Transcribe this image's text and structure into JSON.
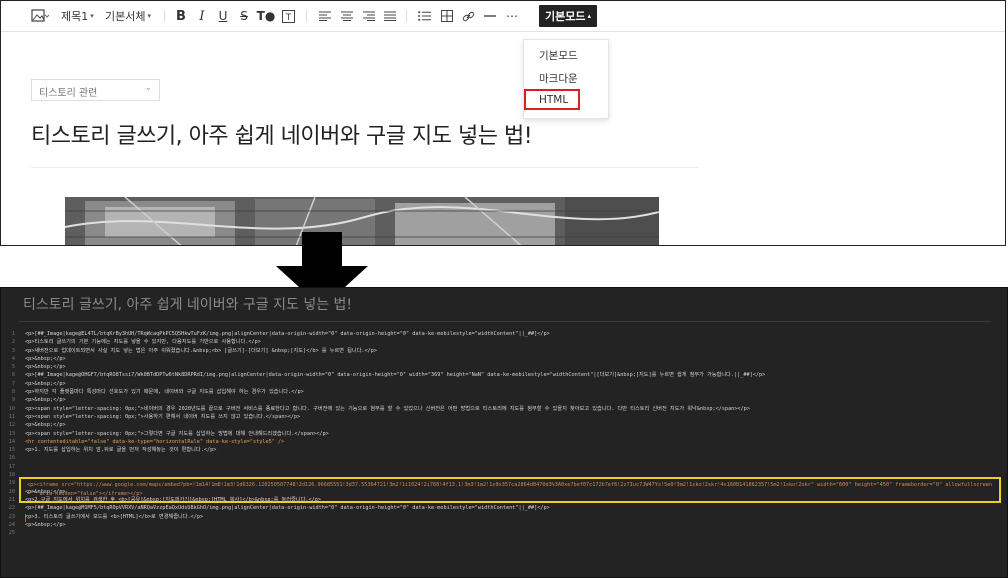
{
  "toolbar": {
    "heading_label": "제목1",
    "font_label": "기본서체",
    "mode_label": "기본모드",
    "mode_menu": [
      "기본모드",
      "마크다운",
      "HTML"
    ]
  },
  "editor": {
    "category": "티스토리 관련",
    "title": "티스토리 글쓰기, 아주 쉽게 네이버와 구글 지도 넣는 법!"
  },
  "source": {
    "title": "티스토리 글쓰기, 아주 쉽게 네이버와 구글 지도 넣는 법!",
    "line_numbers": [
      "1",
      "2",
      "3",
      "4",
      "5",
      "6",
      "7",
      "8",
      "9",
      "10",
      "11",
      "12",
      "13",
      "14",
      "15",
      "16",
      "17",
      "18",
      "19",
      "20",
      "21",
      "22",
      "23",
      "24",
      "25"
    ],
    "lines": [
      "<p>[##_Image|kage@EL4TL/btqKrBy3hUH/TRqWcaqPkPC5Q5HkwTuFzK/img.png|alignCenter|data-origin-width=\"0\" data-origin-height=\"0\" data-ke-mobilestyle=\"widthContent\"||_##]</p>",
      "<p>티스토리 글쓰기의 기본 기능에는 지도를 넣을 수 있지만, 다음지도를 기반으로 사용합니다.</p>",
      "<p>새버전으로 업데이트되면서 사실 지도 넣는 법은 아주 쉬워졌습니다.&nbsp;<b> [글쓰기]-[더보기] &nbsp;[지도]</b> 를 누르면 됩니다.</p>",
      "<p>&nbsp;</p>",
      "<p>&nbsp;</p>",
      "<p>[##_Image|kage@OHGF7/btqRO8Tssi7/Wk0BTdDPTw6tNk8DRPRdI/img.png|alignCenter|data-origin-width=\"0\" data-origin-height=\"0\" width=\"369\" height=\"NaN\" data-ke-mobilestyle=\"widthContent\"|[더보기]&nbsp;[지도]를 누르면 쉽게 첨부가 가능합니다.||_##]</p>",
      "<p>&nbsp;</p>",
      "<p>하지만 각 플랫폼마다 특성마다 선호도가 있기 때문에, 네이버와 구글 지도를 삽입해야 하는 경우가 있습니다.</p>",
      "<p>&nbsp;</p>",
      "<p><span style=\"letter-spacing: 0px;\">네이버의 경우 2020년도를 끝으로 구버전 서비스를 종료한다고 합니다. 구버전에 있는 기능으로 첨부를 할 수 있었으나 신버전은 어떤 방법으로 티스토리에 지도를 첨부할 수 있을지 찾아보고 있습니다. 다만 티스토리 신버전 지도가 워낙&nbsp;</span></p>",
      "<p><span style=\"letter-spacing: 0px;\">사용하기 편해서 네이버 지도를 쓰지 않고 있습니다.</span></p>",
      "<p>&nbsp;</p>",
      "<p><span style=\"letter-spacing: 0px;\">그렇다면 구글 지도를 삽입하는 방법에 대해 안내해드리겠습니다.</span></p>",
      "<hr contenteditable=\"false\" data-ke-type=\"horizontalRule\" data-ke-style=\"style5\" />",
      "<p>1. 지도를 삽입하는 위치 앞,뒤로 글을 먼저 작성해놓는 것이 편합니다.</p>",
      "",
      "",
      "",
      "",
      "<p>&nbsp;</p>",
      "<p>2.구글 지도에서 위치를 검색한 후 <b>[공유]&nbsp;[지도퍼가기]&nbsp;[HTML 복사]</b>&nbsp;를 눌러줍니다.</p>",
      "<p>[##_Image|kage@M1MF5/btqR0pVVRXV/aNRQaVzzpEaQxUdsU8kGhO/img.png|alignCenter|data-origin-width=\"0\" data-origin-height=\"0\" data-ke-mobilestyle=\"widthContent\"||_##]</p>",
      "<p>3. 티스토리 글쓰기에서 모드를 <b>[HTML]</b>로 변경해줍니다.</p>",
      "<p>&nbsp;</p>",
      ""
    ],
    "iframe_code": "<p><iframe src=\"https://www.google.com/maps/embed?pb=!1m14!1m8!1m3!1d6326.120250507748!2d126.96685551!3d37.55364721!3m2!1i1024!2i768!4f13.1!3m3!1m2!1s0x357ca2864d8470d3%3A0xe7bef07c172b7ef6!2z7Iuc7JW47Ys!5e0!3m2!1sko!2skr!4v1608141862357!5m2!1sko!2skr\" width=\"600\" height=\"450\" frameborder=\"0\" allowfullscreen=\"\" aria-hidden=\"false\"></iframe></p>"
  }
}
